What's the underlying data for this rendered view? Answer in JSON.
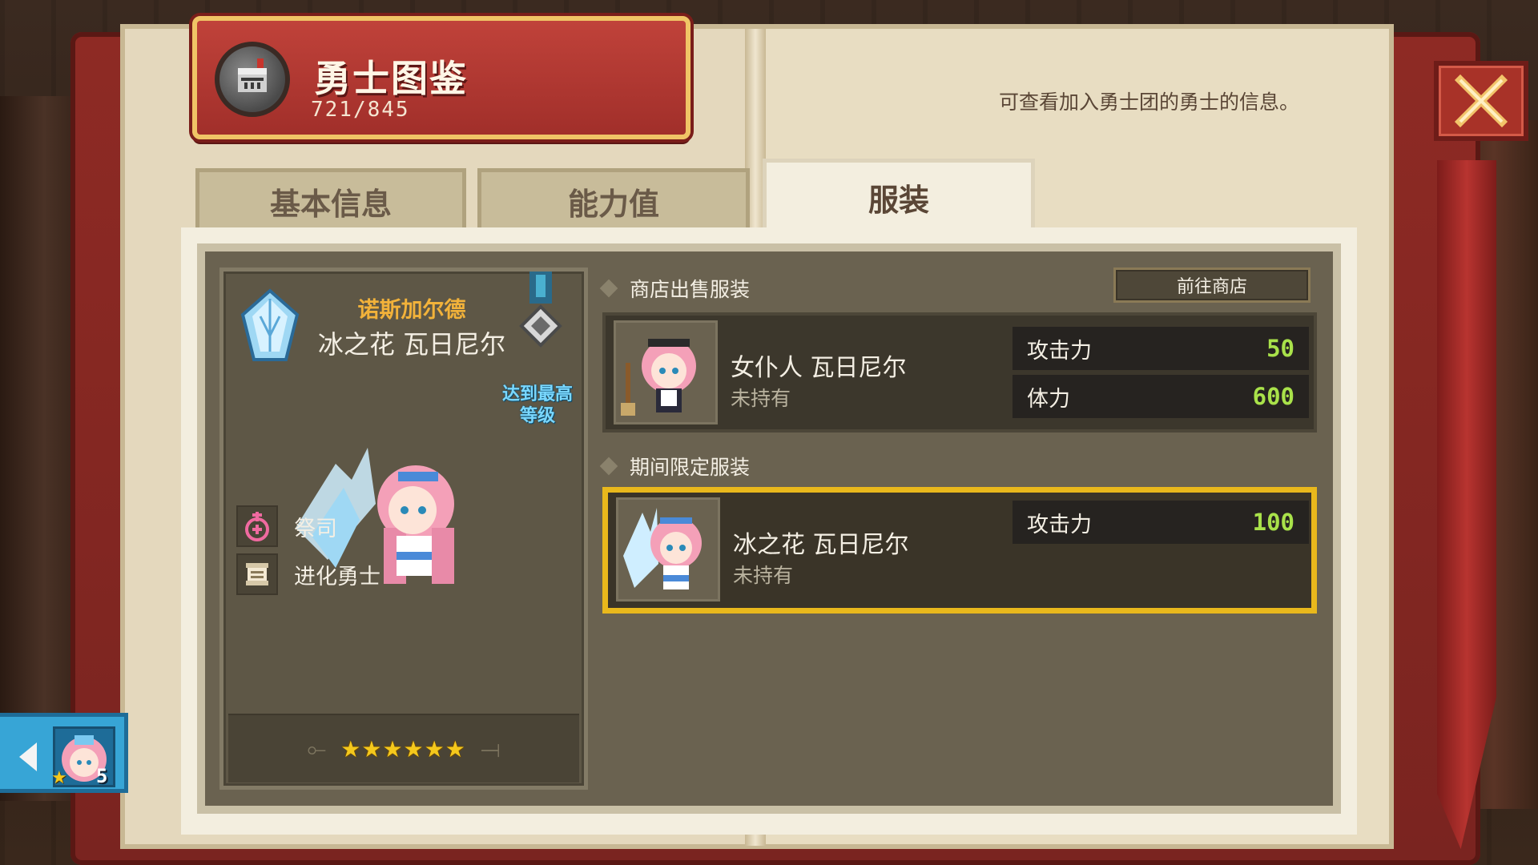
{
  "header": {
    "title": "勇士图鉴",
    "count": "721/845",
    "description": "可查看加入勇士团的勇士的信息。"
  },
  "tabs": [
    {
      "label": "基本信息",
      "active": false
    },
    {
      "label": "能力值",
      "active": false
    },
    {
      "label": "服装",
      "active": true
    }
  ],
  "hero": {
    "title": "诺斯加尔德",
    "name": "冰之花 瓦日尼尔",
    "max_level_badge": "达到最高等级",
    "role": "祭司",
    "type": "进化勇士",
    "stars": "★★★★★★",
    "star_count": 6
  },
  "shop_section": {
    "heading": "商店出售服装",
    "goto_shop_label": "前往商店",
    "items": [
      {
        "name": "女仆人 瓦日尼尔",
        "status": "未持有",
        "stats": [
          {
            "label": "攻击力",
            "value": "50"
          },
          {
            "label": "体力",
            "value": "600"
          }
        ]
      }
    ]
  },
  "limited_section": {
    "heading": "期间限定服装",
    "items": [
      {
        "name": "冰之花 瓦日尼尔",
        "status": "未持有",
        "selected": true,
        "stats": [
          {
            "label": "攻击力",
            "value": "100"
          }
        ]
      }
    ]
  },
  "side_hero": {
    "level": "5"
  },
  "colors": {
    "accent_gold": "#e9b81c",
    "stat_value_green": "#a9e24a",
    "title_red": "#a12f2a",
    "hero_title_gold": "#f2b23a"
  },
  "icons": [
    "helmet-icon",
    "close-icon",
    "crystal-icon",
    "medal-icon",
    "priest-icon",
    "scroll-icon",
    "star-icon",
    "arrow-left-icon"
  ]
}
